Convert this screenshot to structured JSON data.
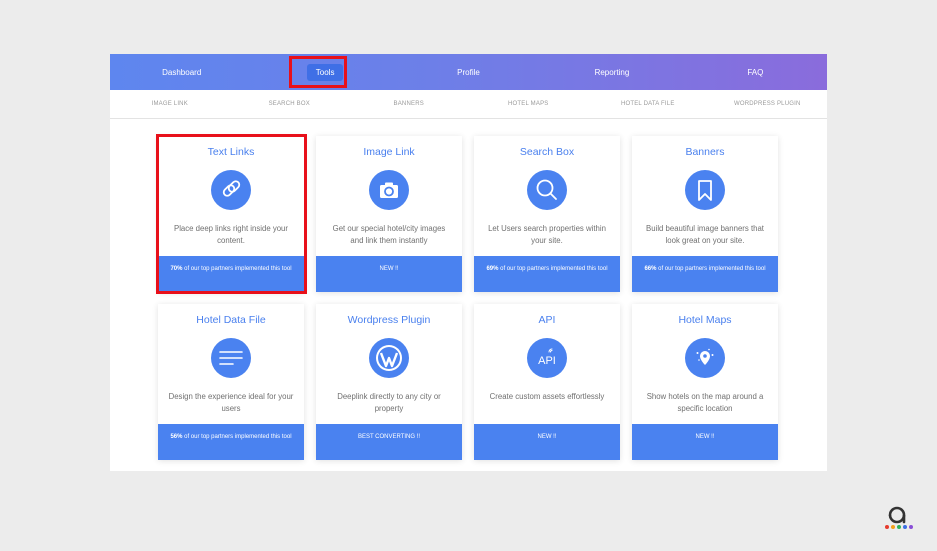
{
  "nav": {
    "items": [
      {
        "label": "Dashboard"
      },
      {
        "label": "Tools"
      },
      {
        "label": "Profile"
      },
      {
        "label": "Reporting"
      },
      {
        "label": "FAQ"
      }
    ]
  },
  "subnav": {
    "items": [
      {
        "label": "IMAGE LINK"
      },
      {
        "label": "SEARCH BOX"
      },
      {
        "label": "BANNERS"
      },
      {
        "label": "HOTEL MAPS"
      },
      {
        "label": "HOTEL DATA FILE"
      },
      {
        "label": "WORDPRESS PLUGIN"
      }
    ]
  },
  "cards": [
    {
      "title": "Text Links",
      "icon": "chain-link-icon",
      "desc": "Place deep links right inside your content.",
      "footer_pct": "70%",
      "footer_text": " of our top partners implemented this tool"
    },
    {
      "title": "Image Link",
      "icon": "camera-icon",
      "desc": "Get our special hotel/city images and link them instantly",
      "footer_pct": "",
      "footer_text": "NEW !!"
    },
    {
      "title": "Search Box",
      "icon": "magnifier-icon",
      "desc": "Let Users search properties within your site.",
      "footer_pct": "69%",
      "footer_text": " of our top partners implemented this tool"
    },
    {
      "title": "Banners",
      "icon": "bookmark-icon",
      "desc": "Build beautiful image banners that look great on your site.",
      "footer_pct": "66%",
      "footer_text": " of our top partners implemented this tool"
    },
    {
      "title": "Hotel Data File",
      "icon": "lines-icon",
      "desc": "Design the experience ideal for your users",
      "footer_pct": "56%",
      "footer_text": " of our top partners implemented this tool"
    },
    {
      "title": "Wordpress Plugin",
      "icon": "wordpress-icon",
      "desc": "Deeplink directly to any city or property",
      "footer_pct": "",
      "footer_text": "BEST CONVERTING !!"
    },
    {
      "title": "API",
      "icon": "api-icon",
      "desc": "Create custom assets effortlessly",
      "footer_pct": "",
      "footer_text": "NEW !!"
    },
    {
      "title": "Hotel Maps",
      "icon": "map-pin-icon",
      "desc": "Show hotels on the map around a specific location",
      "footer_pct": "",
      "footer_text": "NEW !!"
    }
  ],
  "icons": {
    "api_text": "API"
  },
  "colors": {
    "accent": "#4a82f0",
    "highlight": "#e8101a",
    "nav_start": "#5e86ef",
    "nav_end": "#8a6cdc"
  }
}
